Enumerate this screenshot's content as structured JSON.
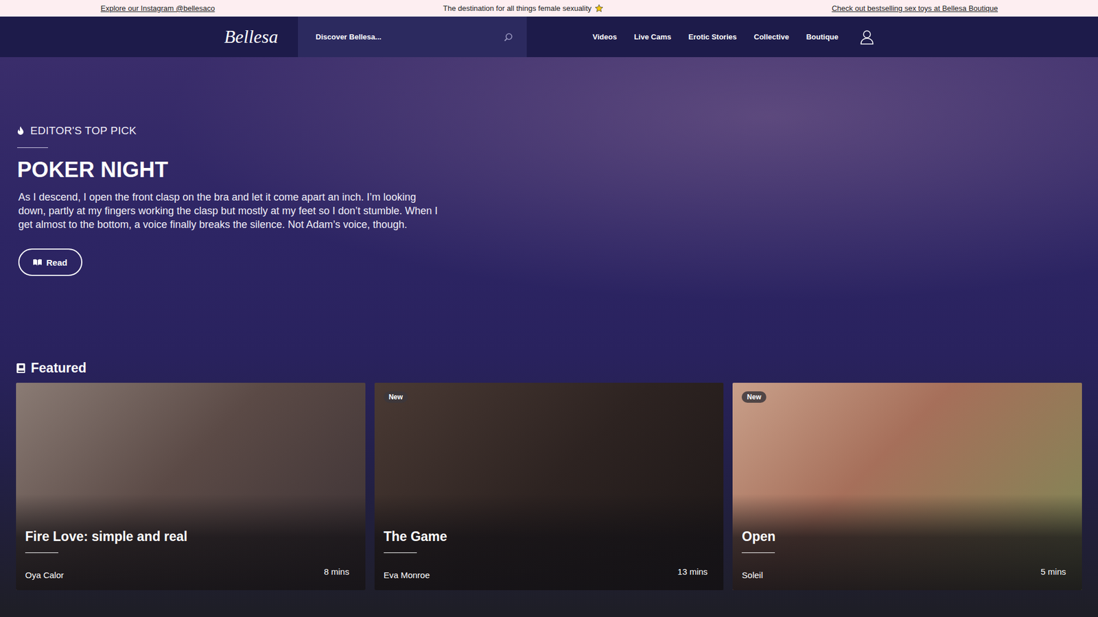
{
  "topbar": {
    "left": "Explore our Instagram @bellesaco",
    "center": "The destination for all things female sexuality",
    "right": "Check out bestselling sex toys at Bellesa Boutique"
  },
  "nav": {
    "logo": "Bellesa",
    "search_placeholder": "Discover Bellesa...",
    "links": [
      "Videos",
      "Live Cams",
      "Erotic Stories",
      "Collective",
      "Boutique"
    ]
  },
  "hero": {
    "eyebrow": "EDITOR'S TOP PICK",
    "title": "POKER NIGHT",
    "excerpt": "As I descend, I open the front clasp on the bra and let it come apart an inch. I’m looking down, partly at my fingers working the clasp but mostly at my feet so I don’t stumble. When I get almost to the bottom, a voice finally breaks the silence. Not Adam’s voice, though.",
    "button": "Read"
  },
  "featured": {
    "heading": "Featured",
    "new_label": "New",
    "cards": [
      {
        "title": "Fire Love: simple and real",
        "author": "Oya Calor",
        "duration": "8 mins",
        "new": false
      },
      {
        "title": "The Game",
        "author": "Eva Monroe",
        "duration": "13 mins",
        "new": true
      },
      {
        "title": "Open",
        "author": "Soleil",
        "duration": "5 mins",
        "new": true
      }
    ]
  }
}
